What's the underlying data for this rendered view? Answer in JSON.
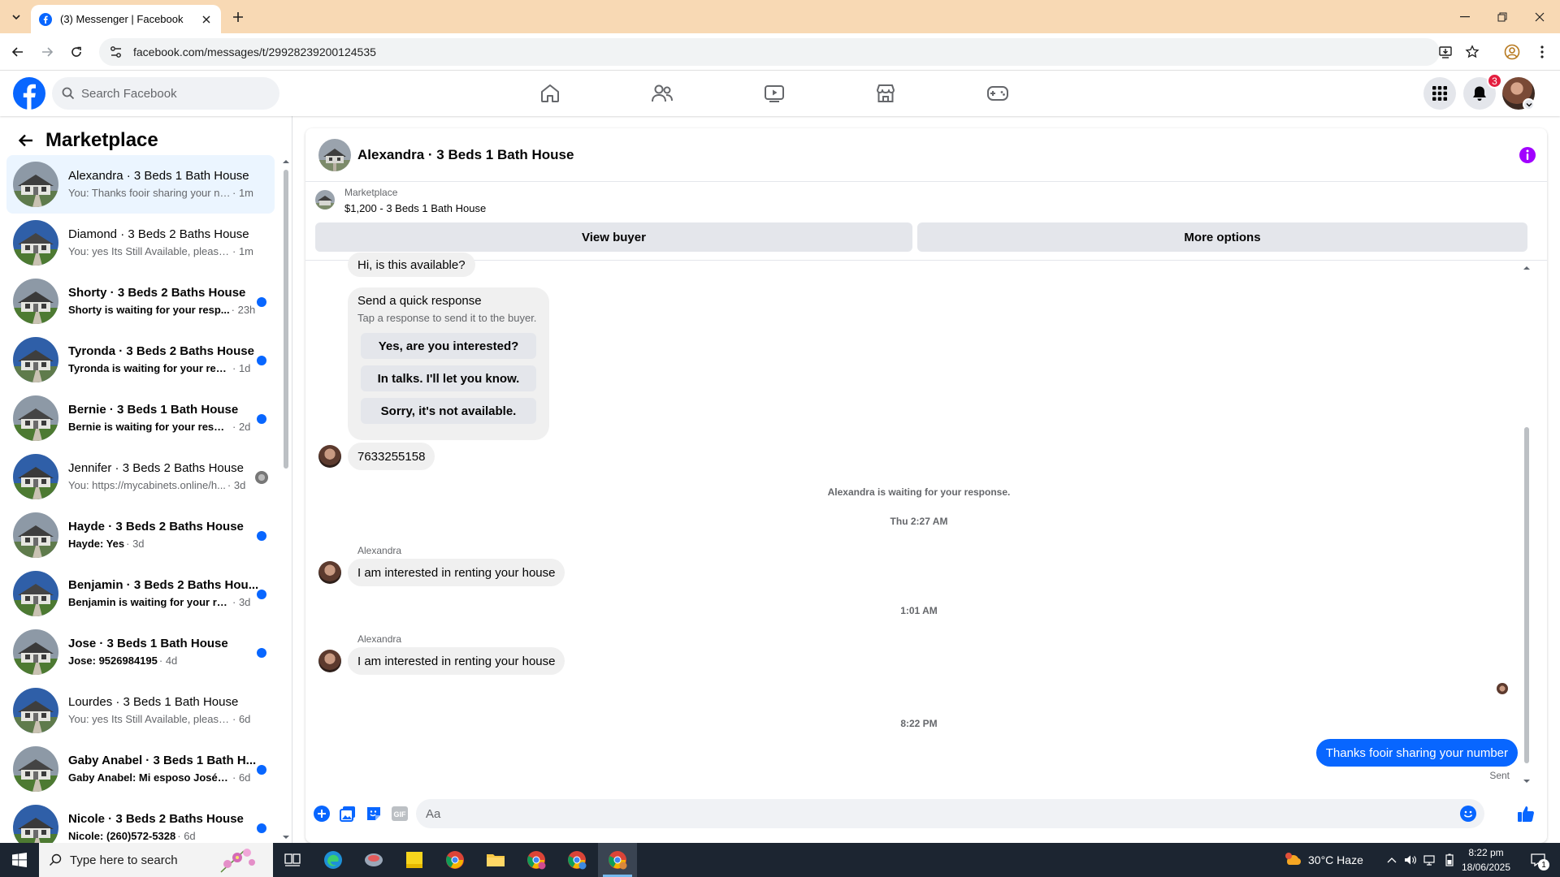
{
  "browser": {
    "tab_title": "(3) Messenger | Facebook",
    "url": "facebook.com/messages/t/29928239200124535"
  },
  "fb": {
    "search_placeholder": "Search Facebook",
    "notification_count": "3",
    "brand_color": "#0866ff"
  },
  "sidebar": {
    "title": "Marketplace",
    "conversations": [
      {
        "name": "Alexandra · 3 Beds 1 Bath House",
        "preview": "You: Thanks fooir sharing your nu...",
        "time": "· 1m",
        "state": "active"
      },
      {
        "name": "Diamond · 3 Beds 2 Baths House",
        "preview": "You: yes Its Still Available, please S...",
        "time": "· 1m",
        "state": "read"
      },
      {
        "name": "Shorty · 3 Beds 2 Baths House",
        "preview": "Shorty is waiting for your resp...",
        "time": "· 23h",
        "state": "unread"
      },
      {
        "name": "Tyronda · 3 Beds 2 Baths House",
        "preview": "Tyronda is waiting for your resp...",
        "time": "· 1d",
        "state": "unread"
      },
      {
        "name": "Bernie · 3 Beds 1 Bath House",
        "preview": "Bernie is waiting for your respo...",
        "time": "· 2d",
        "state": "unread"
      },
      {
        "name": "Jennifer · 3 Beds 2 Baths House",
        "preview": "You: https://mycabinets.online/h...",
        "time": "· 3d",
        "state": "seen"
      },
      {
        "name": "Hayde · 3 Beds 2 Baths House",
        "preview": "Hayde: Yes",
        "time": "· 3d",
        "state": "unread"
      },
      {
        "name": "Benjamin · 3 Beds 2 Baths Hou...",
        "preview": "Benjamin is waiting for your res...",
        "time": "· 3d",
        "state": "unread"
      },
      {
        "name": "Jose · 3 Beds 1 Bath House",
        "preview": "Jose: 9526984195",
        "time": "· 4d",
        "state": "unread"
      },
      {
        "name": "Lourdes · 3 Beds 1 Bath House",
        "preview": "You: yes Its Still Available, please Se...",
        "time": "· 6d",
        "state": "read"
      },
      {
        "name": "Gaby Anabel · 3 Beds 1 Bath H...",
        "preview": "Gaby Anabel: Mi esposo José C...",
        "time": "· 6d",
        "state": "unread"
      },
      {
        "name": "Nicole · 3 Beds 2 Baths House",
        "preview": "Nicole: (260)572-5328",
        "time": "· 6d",
        "state": "unread"
      }
    ]
  },
  "chat": {
    "title": "Alexandra · 3 Beds 1 Bath House",
    "listing_category": "Marketplace",
    "listing_title": "$1,200 - 3 Beds 1 Bath House",
    "view_buyer": "View buyer",
    "more_options": "More options",
    "first_msg": "Hi, is this available?",
    "quick_title": "Send a quick response",
    "quick_sub": "Tap a response to send it to the buyer.",
    "quick_1": "Yes, are you interested?",
    "quick_2": "In talks. I'll let you know.",
    "quick_3": "Sorry, it's not available.",
    "phone_msg": "7633255158",
    "waiting_note": "Alexandra is waiting for your response.",
    "ts_1": "Thu 2:27 AM",
    "sender": "Alexandra",
    "msg_interested_1": "I am interested in renting your house",
    "ts_2": "1:01 AM",
    "msg_interested_2": "I am interested in renting your house",
    "ts_3": "8:22 PM",
    "out_msg": "Thanks fooir sharing your number",
    "sent_label": "Sent",
    "composer_placeholder": "Aa"
  },
  "taskbar": {
    "search_placeholder": "Type here to search",
    "weather": "30°C  Haze",
    "time": "8:22 pm",
    "date": "18/06/2025",
    "notif_count": "1"
  }
}
